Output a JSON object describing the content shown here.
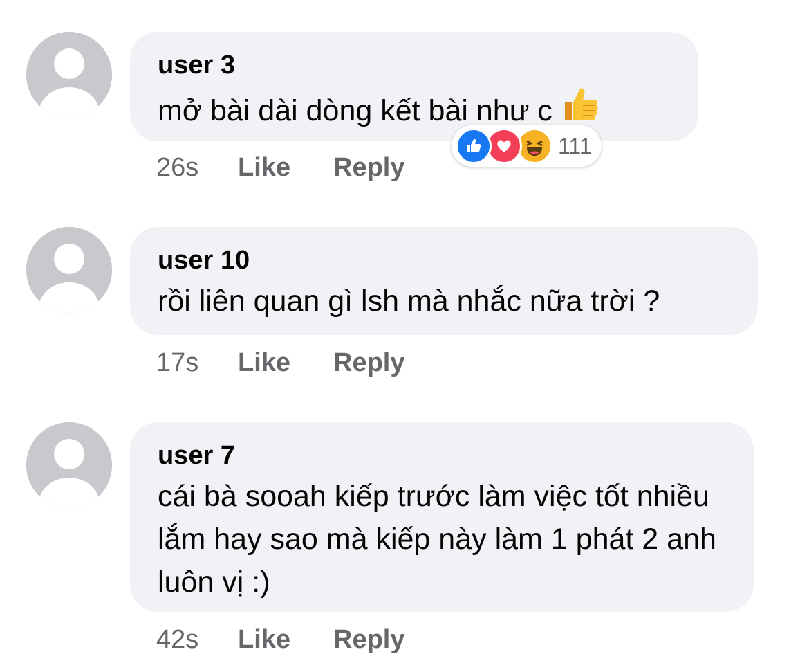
{
  "comments": [
    {
      "author": "user 3",
      "text": "mở bài dài dòng kết bài như c",
      "time": "26s",
      "like_label": "Like",
      "reply_label": "Reply",
      "emoji_icon": "thumbs-up-icon",
      "reactions": {
        "icons": [
          "like-reaction-icon",
          "love-reaction-icon",
          "haha-reaction-icon"
        ],
        "count": "111"
      }
    },
    {
      "author": "user 10",
      "text": "rồi liên quan gì lsh mà nhắc nữa trời ?",
      "time": "17s",
      "like_label": "Like",
      "reply_label": "Reply"
    },
    {
      "author": "user 7",
      "text": "cái bà sooah kiếp trước làm việc tốt nhiều lắm hay sao mà kiếp này làm 1 phát 2 anh luôn vị :)",
      "time": "42s",
      "like_label": "Like",
      "reply_label": "Reply"
    }
  ],
  "colors": {
    "bubble": "#f0f2f5",
    "meta_text": "#65676b",
    "like_blue": "#1877f2",
    "love_red": "#f33e58",
    "haha_yellow": "#f7b125"
  }
}
